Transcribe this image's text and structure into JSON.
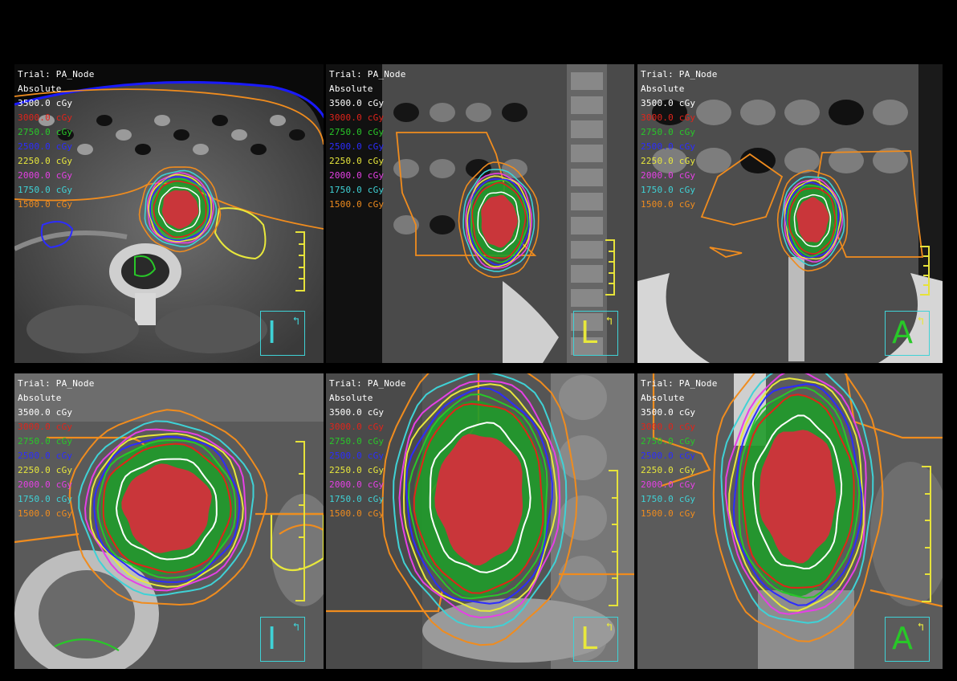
{
  "trial_label": "Trial: PA_Node",
  "mode": "Absolute",
  "isodose_levels": [
    {
      "label": "3500.0 cGy",
      "color": "#ffffff"
    },
    {
      "label": "3000.0 cGy",
      "color": "#e2231a"
    },
    {
      "label": "2750.0 cGy",
      "color": "#28c828"
    },
    {
      "label": "2500.0 cGy",
      "color": "#2c2cff"
    },
    {
      "label": "2250.0 cGy",
      "color": "#e8e83c"
    },
    {
      "label": "2000.0 cGy",
      "color": "#e640e6"
    },
    {
      "label": "1750.0 cGy",
      "color": "#3fd2d6"
    },
    {
      "label": "1500.0 cGy",
      "color": "#f08c1e"
    }
  ],
  "panels": [
    {
      "view": "axial",
      "orientation": "I"
    },
    {
      "view": "sagittal",
      "orientation": "L"
    },
    {
      "view": "coronal",
      "orientation": "A"
    },
    {
      "view": "axial-zoom",
      "orientation": "I"
    },
    {
      "view": "sagittal-zoom",
      "orientation": "L"
    },
    {
      "view": "coronal-zoom",
      "orientation": "A"
    }
  ]
}
